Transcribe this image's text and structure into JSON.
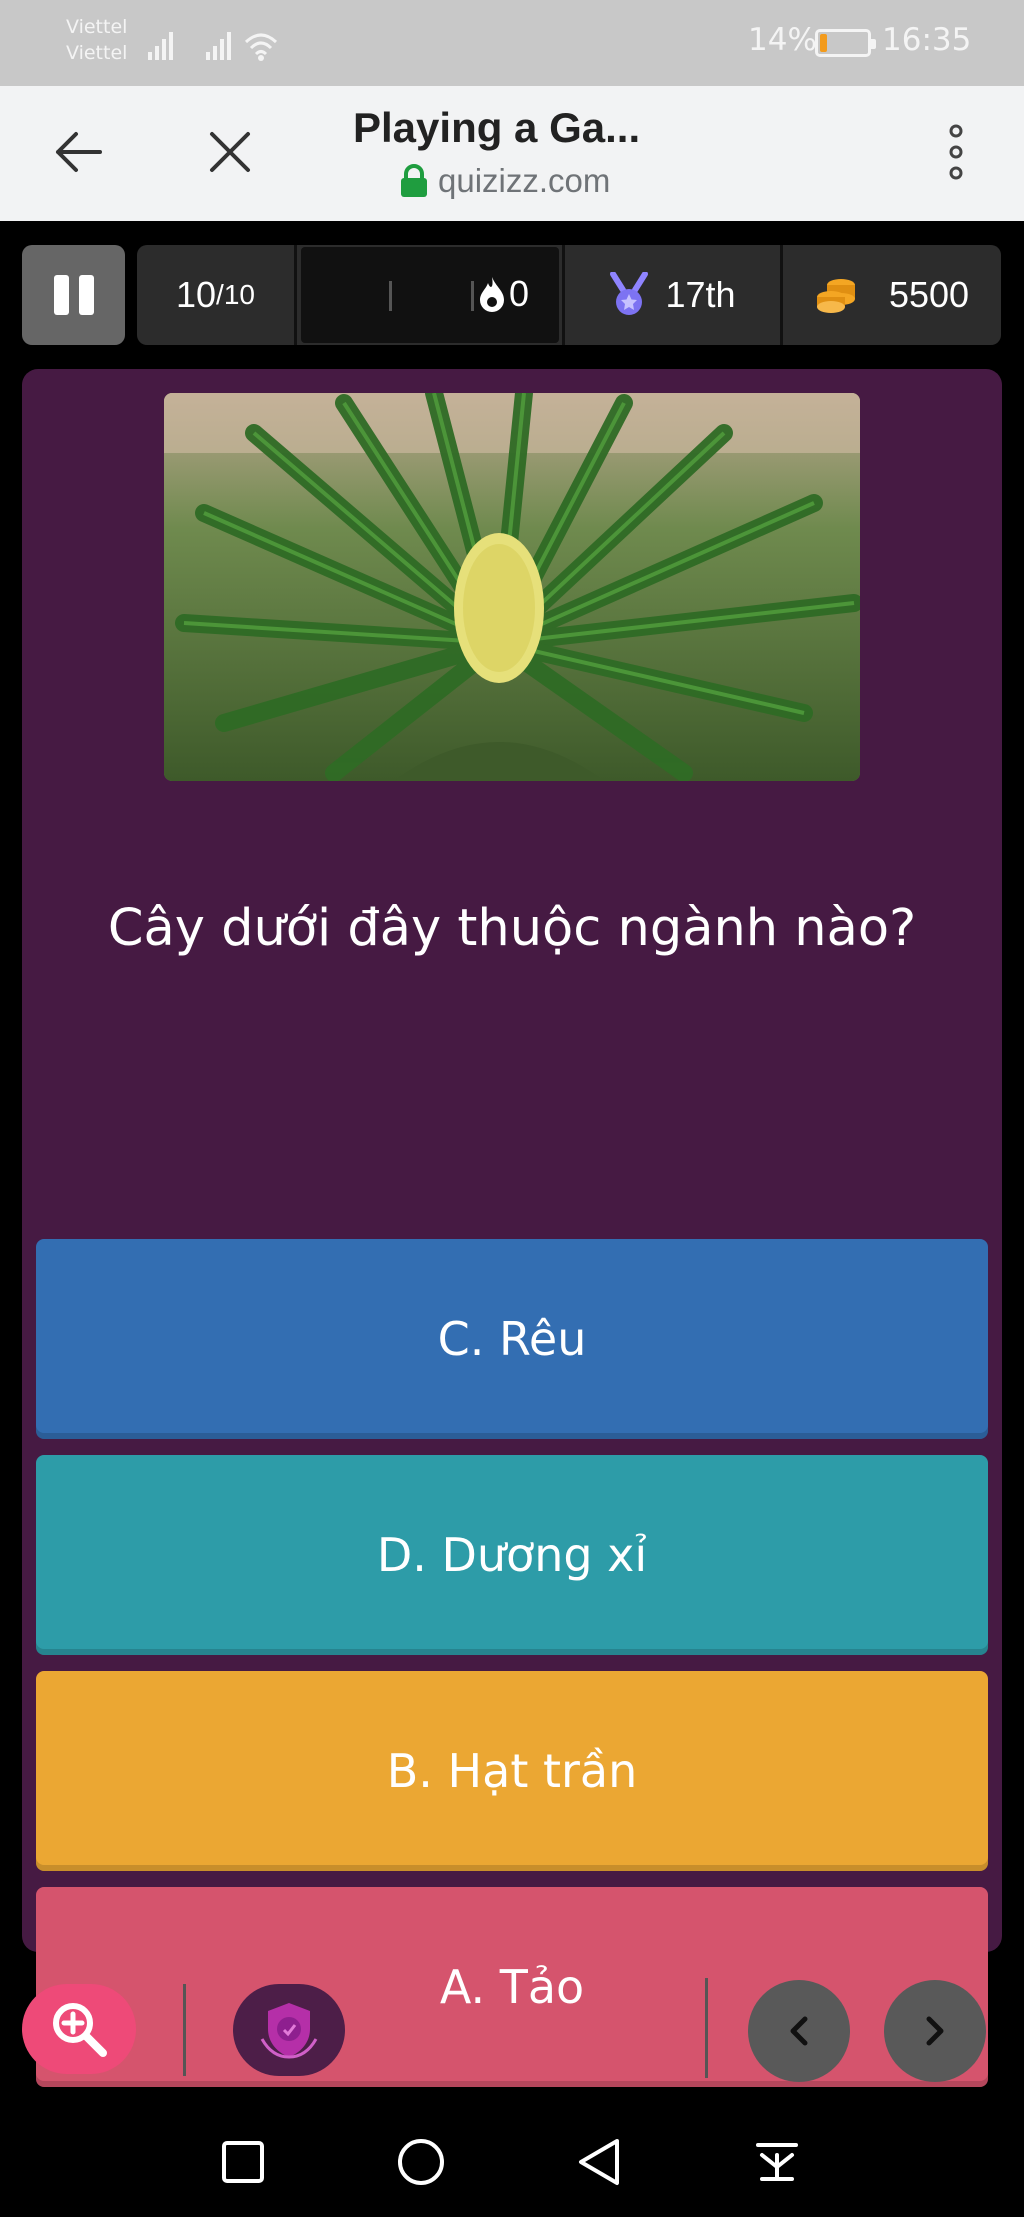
{
  "status_bar": {
    "carrier_1": "Viettel",
    "carrier_2": "Viettel",
    "battery_percent": "14%",
    "battery_level": 0.14,
    "time": "16:35",
    "icons": [
      "signal-icon",
      "signal-icon",
      "wifi-icon",
      "battery-icon"
    ]
  },
  "browser": {
    "title": "Playing a Ga...",
    "url": "quizizz.com",
    "icons": [
      "back-arrow-icon",
      "close-icon",
      "lock-icon",
      "more-vert-icon"
    ]
  },
  "game_header": {
    "question_counter_current": "10",
    "question_counter_total": "/10",
    "streak_count": "0",
    "rank": "17th",
    "coins": "5500",
    "icons": [
      "pause-icon",
      "flame-icon",
      "medal-icon",
      "coins-icon"
    ]
  },
  "question": {
    "image_alt": "Cycad plant",
    "text": "Cây dưới đây thuộc ngành nào?",
    "answers": [
      {
        "label": "C. Rêu",
        "color": "#336eb2"
      },
      {
        "label": "D. Dương xỉ",
        "color": "#2d9ca8"
      },
      {
        "label": "B. Hạt trần",
        "color": "#eba733"
      },
      {
        "label": "A. Tảo",
        "color": "#d5546d"
      }
    ]
  },
  "toolbar": {
    "icons": [
      "zoom-in-icon",
      "powerup-icon",
      "chevron-left-icon",
      "chevron-right-icon"
    ]
  },
  "android_nav": {
    "icons": [
      "recents-icon",
      "home-icon",
      "back-icon",
      "notification-pull-icon"
    ]
  }
}
